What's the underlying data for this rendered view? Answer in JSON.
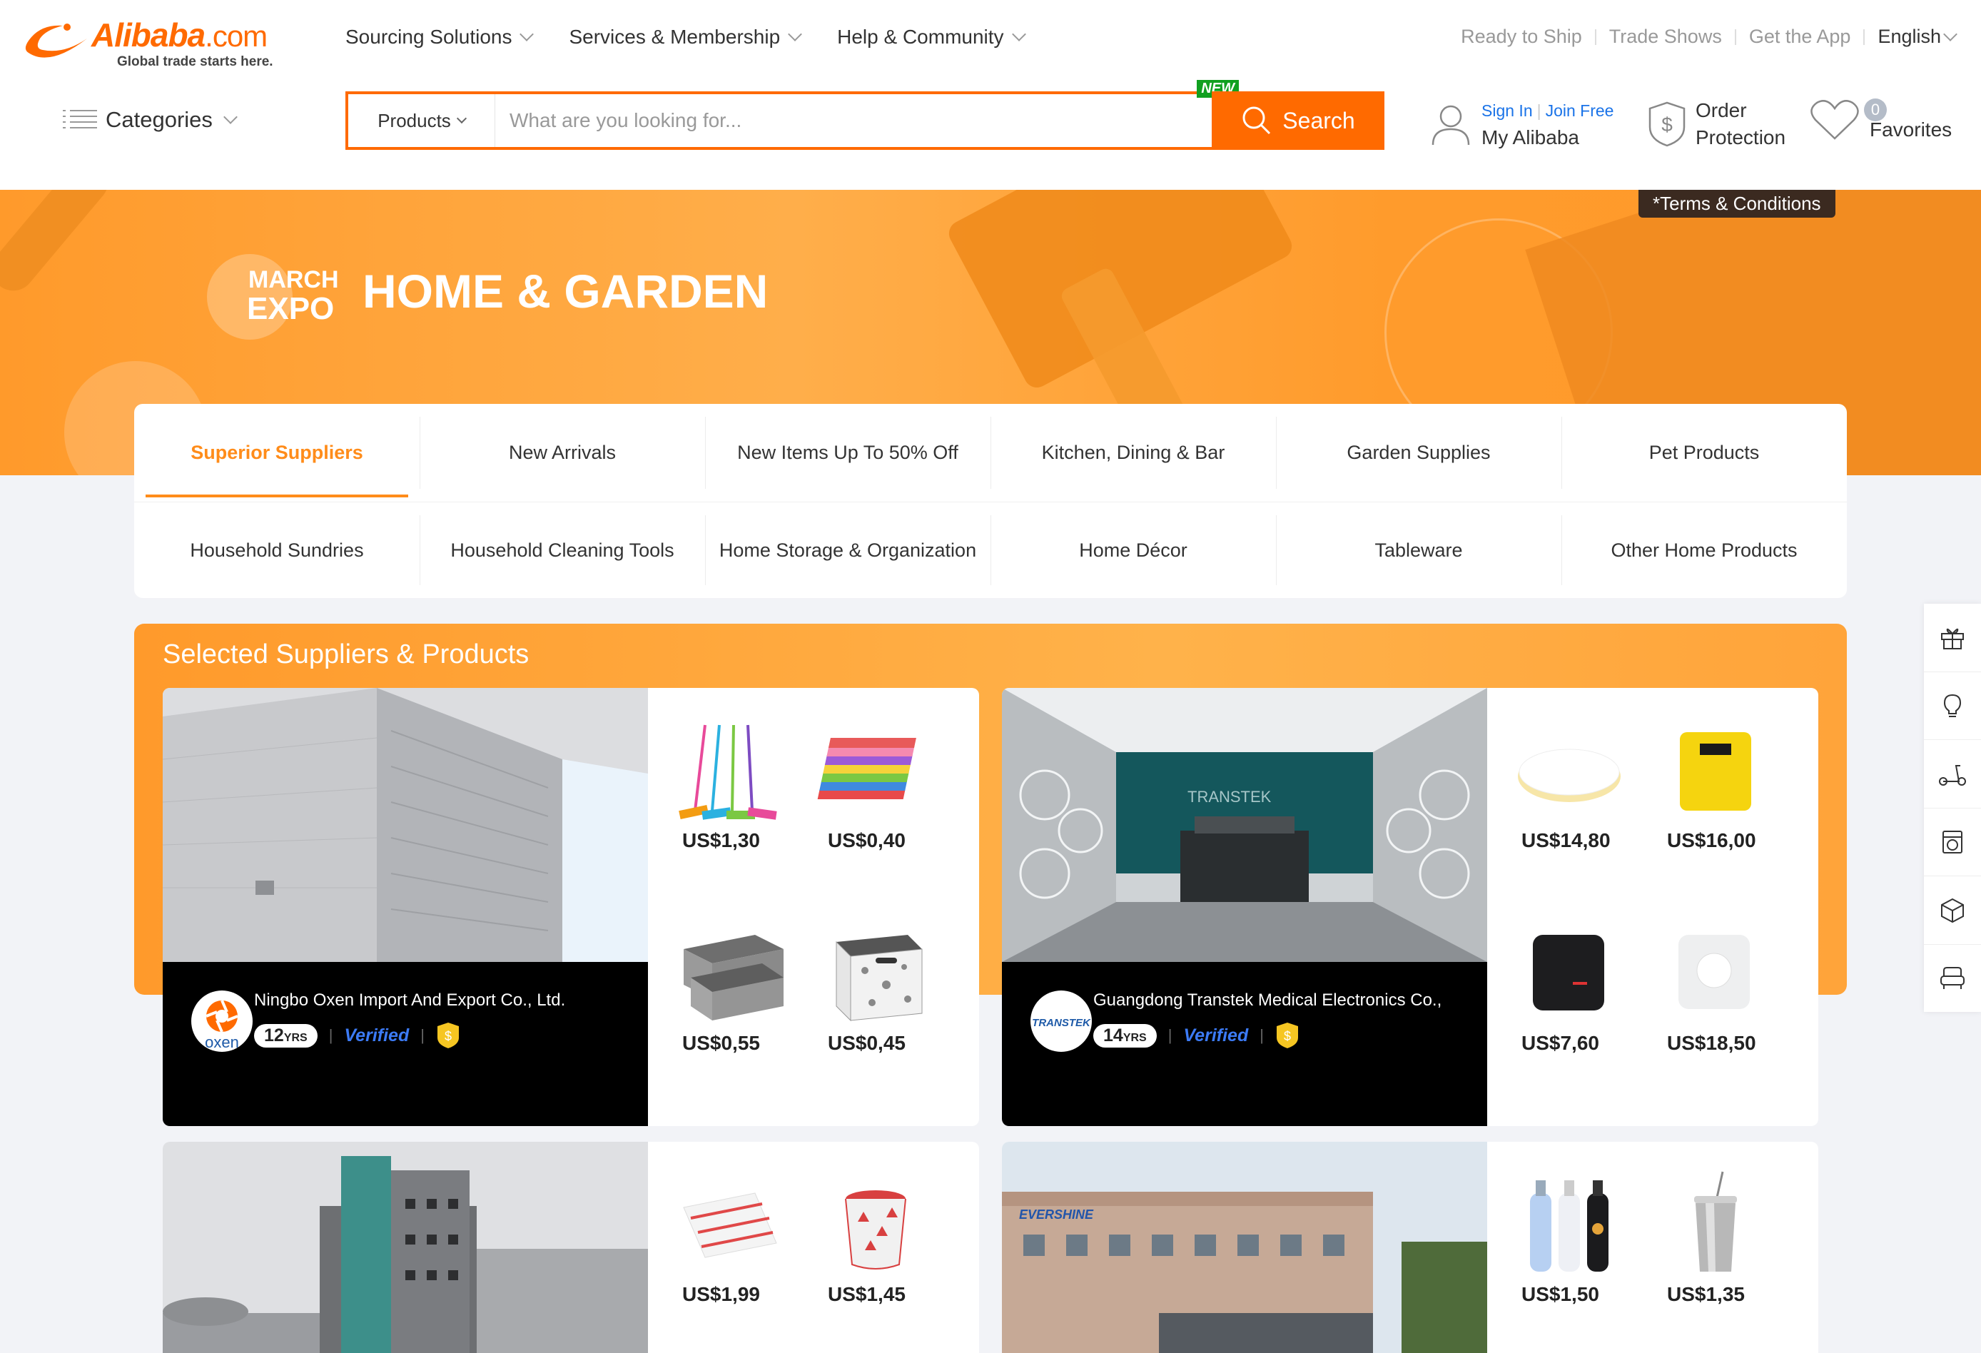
{
  "brand": {
    "name": "Alibaba",
    "suffix": ".com",
    "tagline": "Global trade starts here.",
    "accent": "#ff6a00"
  },
  "topnav": [
    {
      "label": "Sourcing Solutions"
    },
    {
      "label": "Services & Membership"
    },
    {
      "label": "Help & Community"
    }
  ],
  "toplinks": {
    "ready": "Ready to Ship",
    "shows": "Trade Shows",
    "app": "Get the App",
    "lang": "English"
  },
  "categories_label": "Categories",
  "search": {
    "type": "Products",
    "placeholder": "What are you looking for...",
    "button": "Search",
    "new_badge": "NEW"
  },
  "account": {
    "sign_in": "Sign In",
    "join": "Join Free",
    "my": "My Alibaba"
  },
  "protection": {
    "line1": "Order",
    "line2": "Protection"
  },
  "favorites": {
    "count": "0",
    "label": "Favorites"
  },
  "banner": {
    "expo_top": "MARCH",
    "expo_bottom": "EXPO",
    "title": "HOME & GARDEN",
    "terms": "*Terms & Conditions"
  },
  "category_tabs": {
    "row1": [
      "Superior Suppliers",
      "New Arrivals",
      "New Items Up To 50% Off",
      "Kitchen, Dining & Bar",
      "Garden Supplies",
      "Pet Products"
    ],
    "row2": [
      "Household Sundries",
      "Household Cleaning Tools",
      "Home Storage & Organization",
      "Home Décor",
      "Tableware",
      "Other Home Products"
    ],
    "active": "Superior Suppliers"
  },
  "section_title": "Selected Suppliers & Products",
  "suppliers": [
    {
      "name": "Ningbo Oxen Import And Export Co., Ltd.",
      "logo_text": "oxen",
      "years": "12",
      "years_unit": "YRS",
      "verified": "Verified",
      "prices": [
        "US$1,30",
        "US$0,40",
        "US$0,55",
        "US$0,45"
      ]
    },
    {
      "name": "Guangdong Transtek Medical Electronics Co.,",
      "logo_text": "TRANSTEK",
      "years": "14",
      "years_unit": "YRS",
      "verified": "Verified",
      "prices": [
        "US$14,80",
        "US$16,00",
        "US$7,60",
        "US$18,50"
      ]
    },
    {
      "prices": [
        "US$1,99",
        "US$1,45"
      ]
    },
    {
      "photo_sign": "EVERSHINE",
      "prices": [
        "US$1,50",
        "US$1,35"
      ]
    }
  ],
  "sidebar_tools": [
    "gift-icon",
    "lightbulb-icon",
    "scooter-icon",
    "washer-icon",
    "box-icon",
    "armchair-icon"
  ]
}
